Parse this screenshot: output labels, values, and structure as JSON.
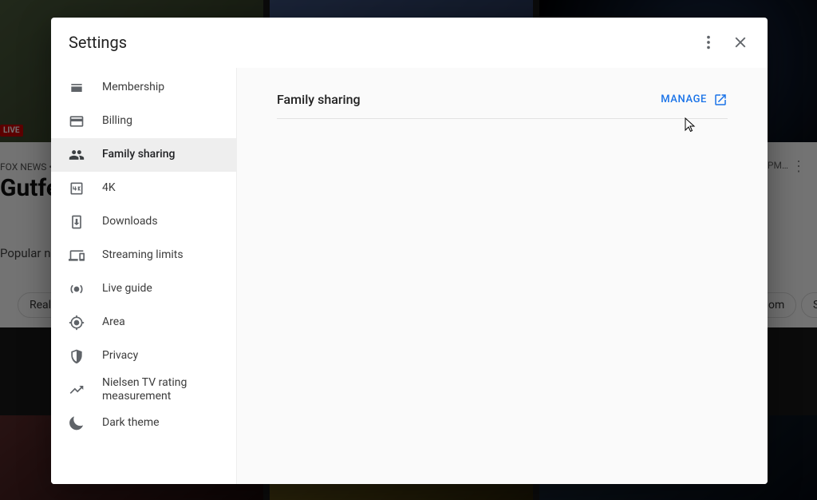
{
  "background": {
    "live_badge": "LIVE",
    "channel_line": "FOX NEWS •",
    "show_title": "Gutfe",
    "popular_label": "Popular no",
    "pill_left": "Realit",
    "pill_right_1": "om",
    "pill_right_2": "Sc",
    "time_hint": "PM…"
  },
  "modal": {
    "title": "Settings"
  },
  "sidebar": {
    "items": [
      {
        "label": "Membership"
      },
      {
        "label": "Billing"
      },
      {
        "label": "Family sharing"
      },
      {
        "label": "4K"
      },
      {
        "label": "Downloads"
      },
      {
        "label": "Streaming limits"
      },
      {
        "label": "Live guide"
      },
      {
        "label": "Area"
      },
      {
        "label": "Privacy"
      },
      {
        "label": "Nielsen TV rating measurement"
      },
      {
        "label": "Dark theme"
      }
    ]
  },
  "content": {
    "section_title": "Family sharing",
    "manage_label": "MANAGE"
  }
}
